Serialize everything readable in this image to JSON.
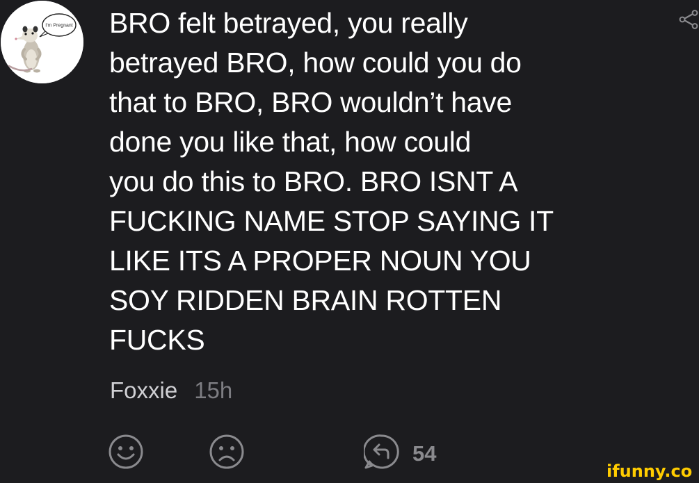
{
  "avatar": {
    "bubble_text": "I'm Pregnant"
  },
  "comment": {
    "text": "BRO felt betrayed, you really\nbetrayed BRO, how could you do\nthat to BRO, BRO wouldn’t have\ndone you like that, how could\nyou do this to BRO. BRO ISNT A\nFUCKING NAME STOP SAYING IT\nLIKE ITS A PROPER NOUN YOU\nSOY RIDDEN BRAIN ROTTEN\nFUCKS",
    "author": "Foxxie",
    "time": "15h"
  },
  "actions": {
    "smile_icon": "smile-icon",
    "frown_icon": "frown-icon",
    "reply_icon": "reply-icon",
    "reply_count": "54"
  },
  "header": {
    "share_icon": "share-icon"
  },
  "watermark": {
    "text": "ifunny.co"
  },
  "colors": {
    "background": "#1c1c1f",
    "text": "#ffffff",
    "author": "#d0d0d4",
    "muted": "#7d7d82",
    "brand": "#ffcc00"
  }
}
